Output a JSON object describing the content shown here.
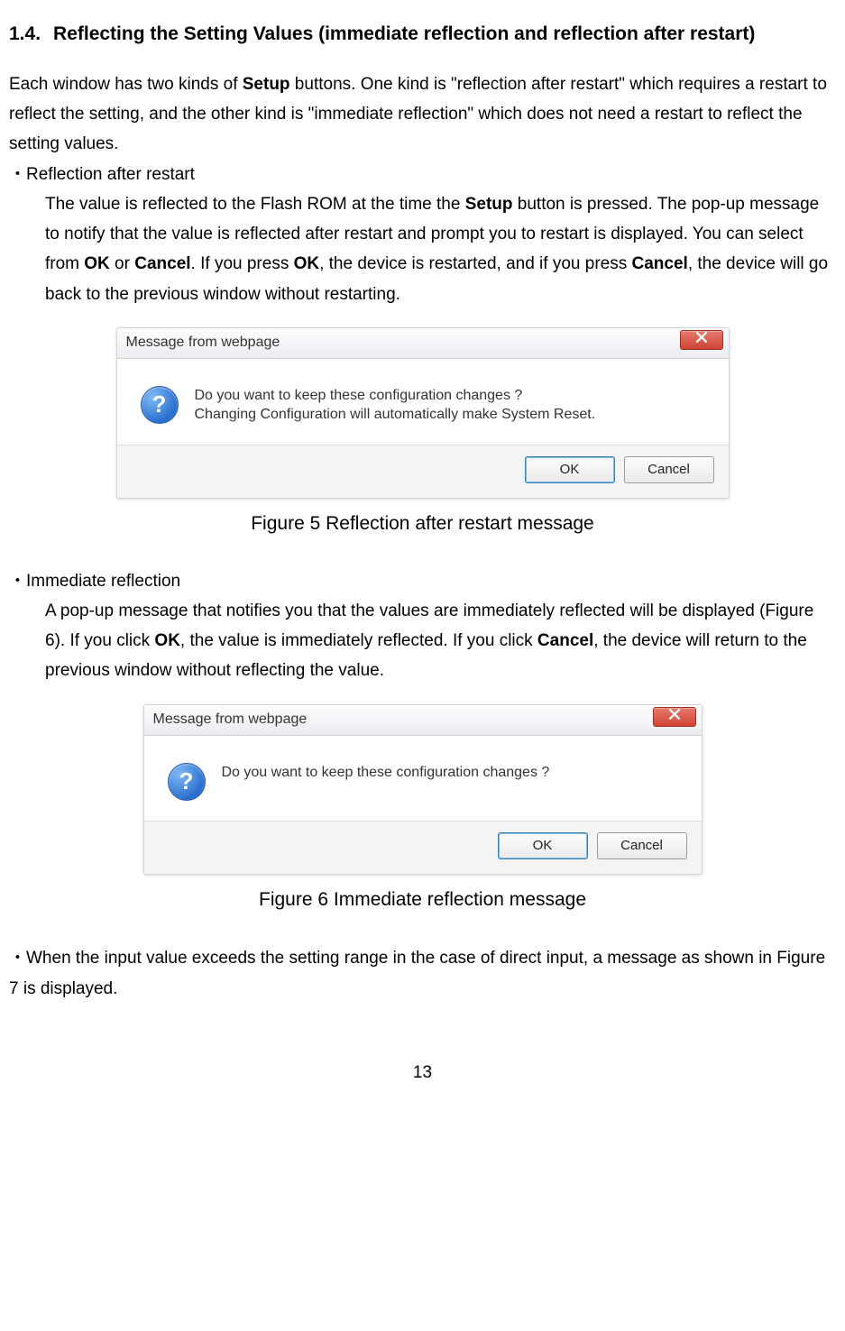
{
  "heading": {
    "number": "1.4.",
    "title": "Reflecting the Setting Values (immediate reflection and reflection after restart)"
  },
  "intro": {
    "t1": "Each window has two kinds of ",
    "t2": "Setup",
    "t3": " buttons. One kind is \"reflection after restart\" which requires a restart to reflect the setting, and the other kind is \"immediate reflection\" which does not need a restart to reflect the setting values."
  },
  "sec1": {
    "bullet": "・Reflection after restart",
    "p1": "The value is reflected to the Flash ROM at the time the ",
    "p2": "Setup",
    "p3": " button is pressed. The pop-up message to notify that the value is reflected after restart and prompt you to restart is displayed. You can select from ",
    "p4": "OK",
    "p5": " or ",
    "p6": "Cancel",
    "p7": ". If you press ",
    "p8": "OK",
    "p9": ", the device is restarted, and if you press ",
    "p10": "Cancel",
    "p11": ", the device will go back to the previous window without restarting."
  },
  "dlg1": {
    "title": "Message from webpage",
    "line1": "Do you want to keep these configuration changes ?",
    "line2": "Changing Configuration will automatically make System Reset.",
    "ok": "OK",
    "cancel": "Cancel"
  },
  "cap1": "Figure 5 Reflection after restart message",
  "sec2": {
    "bullet": "・Immediate reflection",
    "p1": "A pop-up message that notifies you that the values are immediately reflected will be displayed (Figure 6). If you click ",
    "p2": "OK",
    "p3": ", the value is immediately reflected. If you click ",
    "p4": "Cancel",
    "p5": ", the device will return to the previous window without reflecting the value."
  },
  "dlg2": {
    "title": "Message from webpage",
    "line1": "Do you want to keep these configuration changes ?",
    "ok": "OK",
    "cancel": "Cancel"
  },
  "cap2": "Figure 6 Immediate reflection message",
  "note": "・When the input value exceeds the setting range in the case of direct input, a message as shown in Figure 7 is displayed.",
  "pagenum": "13",
  "qmark": "?"
}
